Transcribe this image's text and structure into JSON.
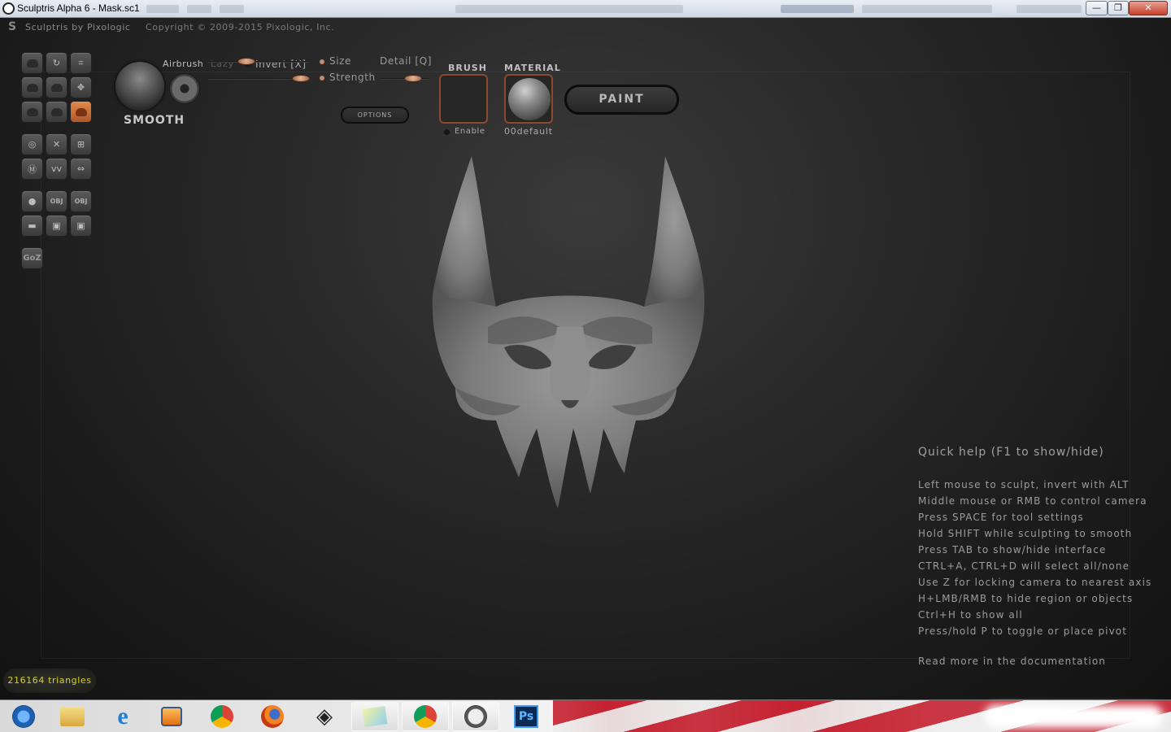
{
  "window": {
    "title": "Sculptris Alpha 6 - Mask.sc1",
    "minimize": "—",
    "maximize": "❐",
    "close": "✕"
  },
  "header": {
    "brand": "Sculptris by Pixologic",
    "copyright": "Copyright © 2009-2015 Pixologic, Inc."
  },
  "brush": {
    "name": "SMOOTH",
    "airbrush_label": "Airbrush",
    "lazy_label": "Lazy",
    "invert_label": "Invert [X]",
    "size_label": "Size",
    "strength_label": "Strength",
    "detail_label": "Detail [Q]",
    "options_label": "OPTIONS",
    "brush_heading": "BRUSH",
    "enable_label": "Enable",
    "material_heading": "MATERIAL",
    "material_name": "00default",
    "paint_label": "PAINT"
  },
  "toolbar": {
    "goz_label": "GoZ",
    "tools": [
      {
        "name": "draw",
        "icon": "draw-icon"
      },
      {
        "name": "rotate",
        "icon": "rotate-icon"
      },
      {
        "name": "crop",
        "icon": "crop-icon"
      },
      {
        "name": "flatten",
        "icon": "flatten-icon"
      },
      {
        "name": "inflate",
        "icon": "inflate-icon"
      },
      {
        "name": "move",
        "icon": "move-icon"
      },
      {
        "name": "pinch",
        "icon": "pinch-icon"
      },
      {
        "name": "crease",
        "icon": "crease-icon"
      },
      {
        "name": "smooth",
        "icon": "smooth-icon",
        "active": true
      },
      {
        "name": "symmetry",
        "icon": "symmetry-icon"
      },
      {
        "name": "wireframe",
        "icon": "wireframe-icon"
      },
      {
        "name": "grid",
        "icon": "grid-icon"
      },
      {
        "name": "mask",
        "icon": "mask-icon"
      },
      {
        "name": "reduce",
        "icon": "reduce-icon"
      },
      {
        "name": "mirror",
        "icon": "mirror-icon"
      },
      {
        "name": "new-sphere",
        "icon": "sphere-icon"
      },
      {
        "name": "import-obj",
        "icon": "import-obj-icon",
        "text": "OBJ"
      },
      {
        "name": "export-obj",
        "icon": "export-obj-icon",
        "text": "OBJ"
      },
      {
        "name": "new-plane",
        "icon": "plane-icon"
      },
      {
        "name": "open",
        "icon": "open-icon"
      },
      {
        "name": "save",
        "icon": "save-icon"
      }
    ]
  },
  "quick_help": {
    "title": "Quick help (F1 to show/hide)",
    "lines": [
      "Left mouse to sculpt, invert with ALT",
      "Middle mouse or RMB to control camera",
      "Press SPACE for tool settings",
      "Hold SHIFT while sculpting to smooth",
      "Press TAB to show/hide interface",
      "CTRL+A, CTRL+D will select all/none",
      "Use Z for locking camera to nearest axis",
      "H+LMB/RMB to hide region or objects",
      "Ctrl+H to show all",
      "Press/hold P to toggle or place pivot"
    ],
    "more": "Read more in the documentation"
  },
  "status": {
    "triangles": "216164 triangles"
  },
  "taskbar": {
    "items": [
      {
        "name": "start",
        "icon": "windows-start-icon"
      },
      {
        "name": "explorer",
        "icon": "folder-icon"
      },
      {
        "name": "internet-explorer",
        "icon": "ie-icon"
      },
      {
        "name": "media-player",
        "icon": "media-player-icon"
      },
      {
        "name": "chrome",
        "icon": "chrome-icon"
      },
      {
        "name": "firefox",
        "icon": "firefox-icon"
      },
      {
        "name": "unity",
        "icon": "unity-icon"
      },
      {
        "name": "notes",
        "icon": "notes-icon"
      },
      {
        "name": "chrome-alt",
        "icon": "chrome-icon"
      },
      {
        "name": "sculptris",
        "icon": "sculptris-icon"
      },
      {
        "name": "photoshop",
        "icon": "photoshop-icon",
        "text": "Ps"
      }
    ]
  }
}
